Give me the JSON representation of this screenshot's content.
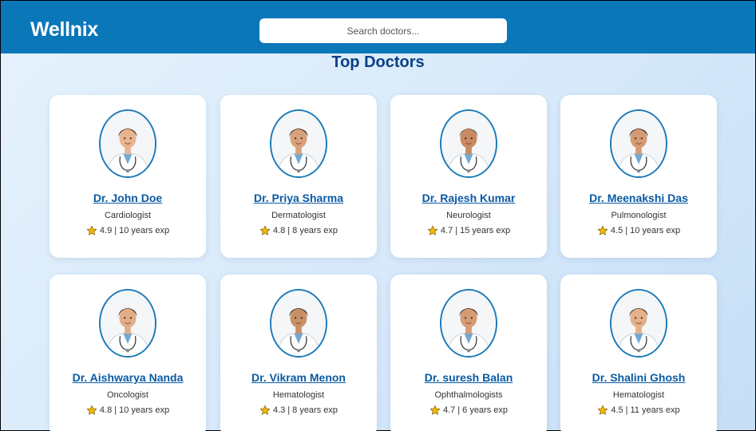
{
  "app": {
    "logo": "Wellnix"
  },
  "search": {
    "placeholder": "Search doctors..."
  },
  "page_title": "Top Doctors",
  "colors": {
    "header": "#0977b8",
    "title": "#0b3f86",
    "link": "#0a5aa3",
    "star": "#f5b800"
  },
  "doctors": [
    {
      "name": "Dr. John Doe",
      "specialty": "Cardiologist",
      "rating": "4.9",
      "experience": "10 years exp"
    },
    {
      "name": "Dr. Priya Sharma",
      "specialty": "Dermatologist",
      "rating": "4.8",
      "experience": "8 years exp"
    },
    {
      "name": "Dr. Rajesh Kumar",
      "specialty": "Neurologist",
      "rating": "4.7",
      "experience": "15 years exp"
    },
    {
      "name": "Dr. Meenakshi Das",
      "specialty": "Pulmonologist",
      "rating": "4.5",
      "experience": "10 years exp"
    },
    {
      "name": "Dr. Aishwarya Nanda",
      "specialty": "Oncologist",
      "rating": "4.8",
      "experience": "10 years exp"
    },
    {
      "name": "Dr. Vikram Menon",
      "specialty": "Hematologist",
      "rating": "4.3",
      "experience": "8 years exp"
    },
    {
      "name": "Dr. suresh Balan",
      "specialty": "Ophthalmologists",
      "rating": "4.7",
      "experience": "6 years exp"
    },
    {
      "name": "Dr. Shalini Ghosh",
      "specialty": "Hematologist",
      "rating": "4.5",
      "experience": "11 years exp"
    }
  ]
}
